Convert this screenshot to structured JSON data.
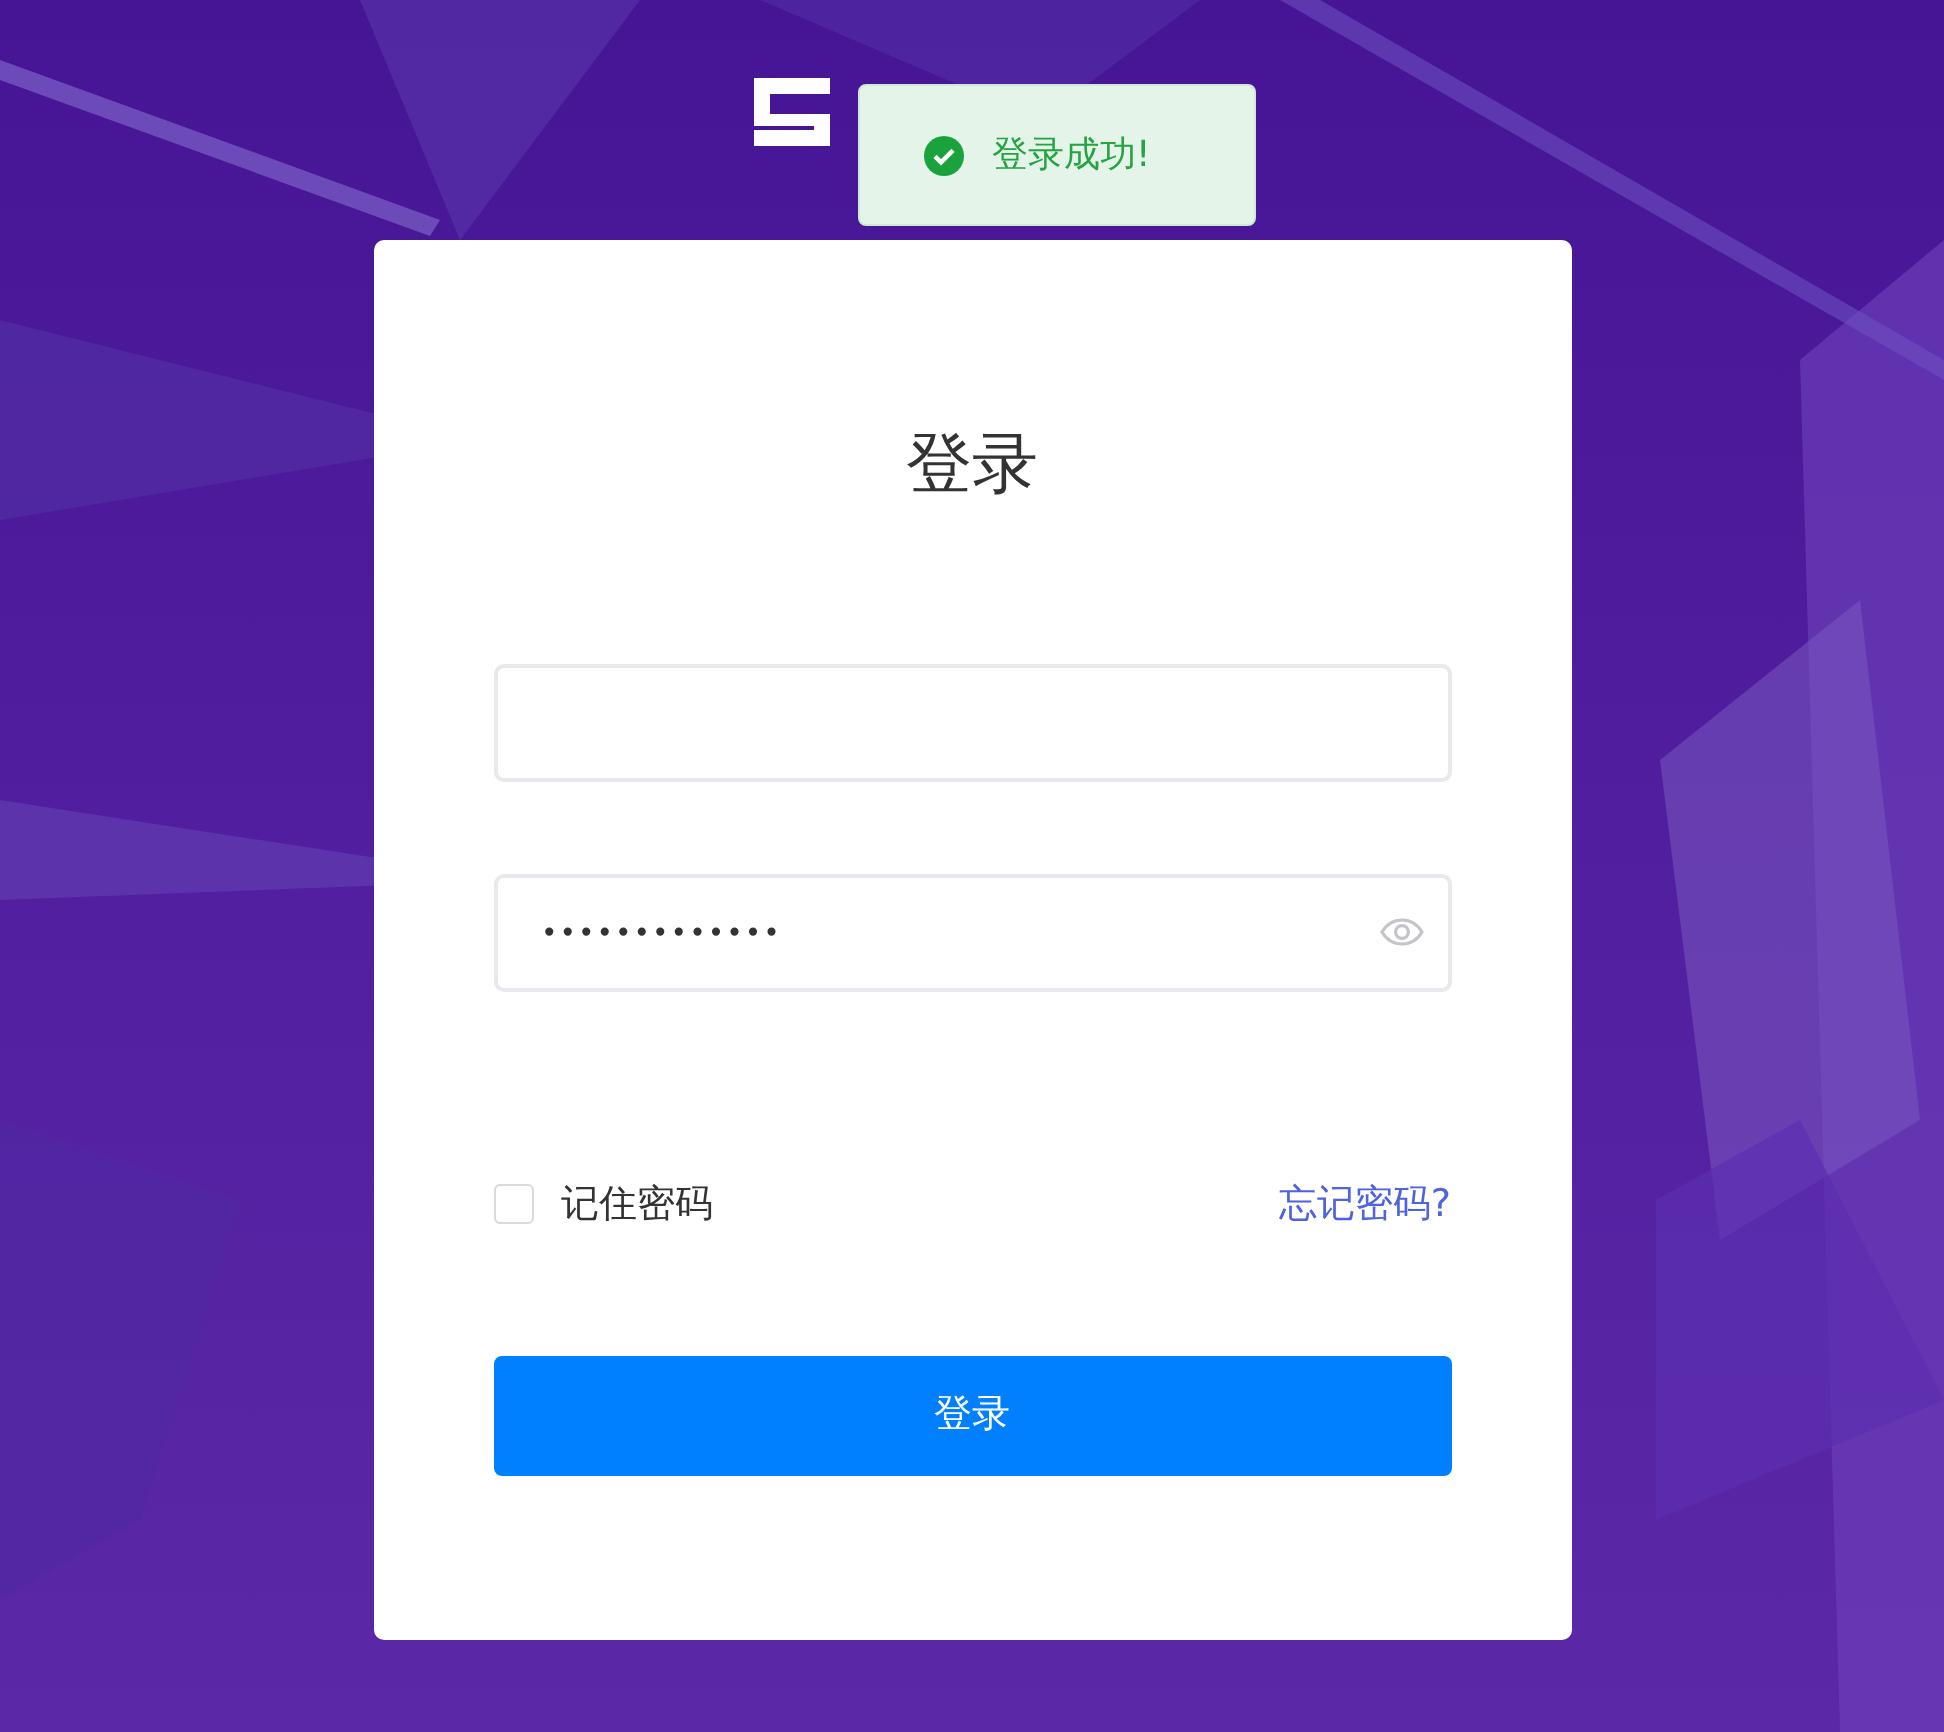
{
  "toast": {
    "kind": "success",
    "message": "登录成功!"
  },
  "login": {
    "title": "登录",
    "password": {
      "value": "•••••••••••••"
    },
    "remember": {
      "label": "记住密码",
      "checked": false
    },
    "forgot_link": "忘记密码?",
    "submit": "登录"
  }
}
